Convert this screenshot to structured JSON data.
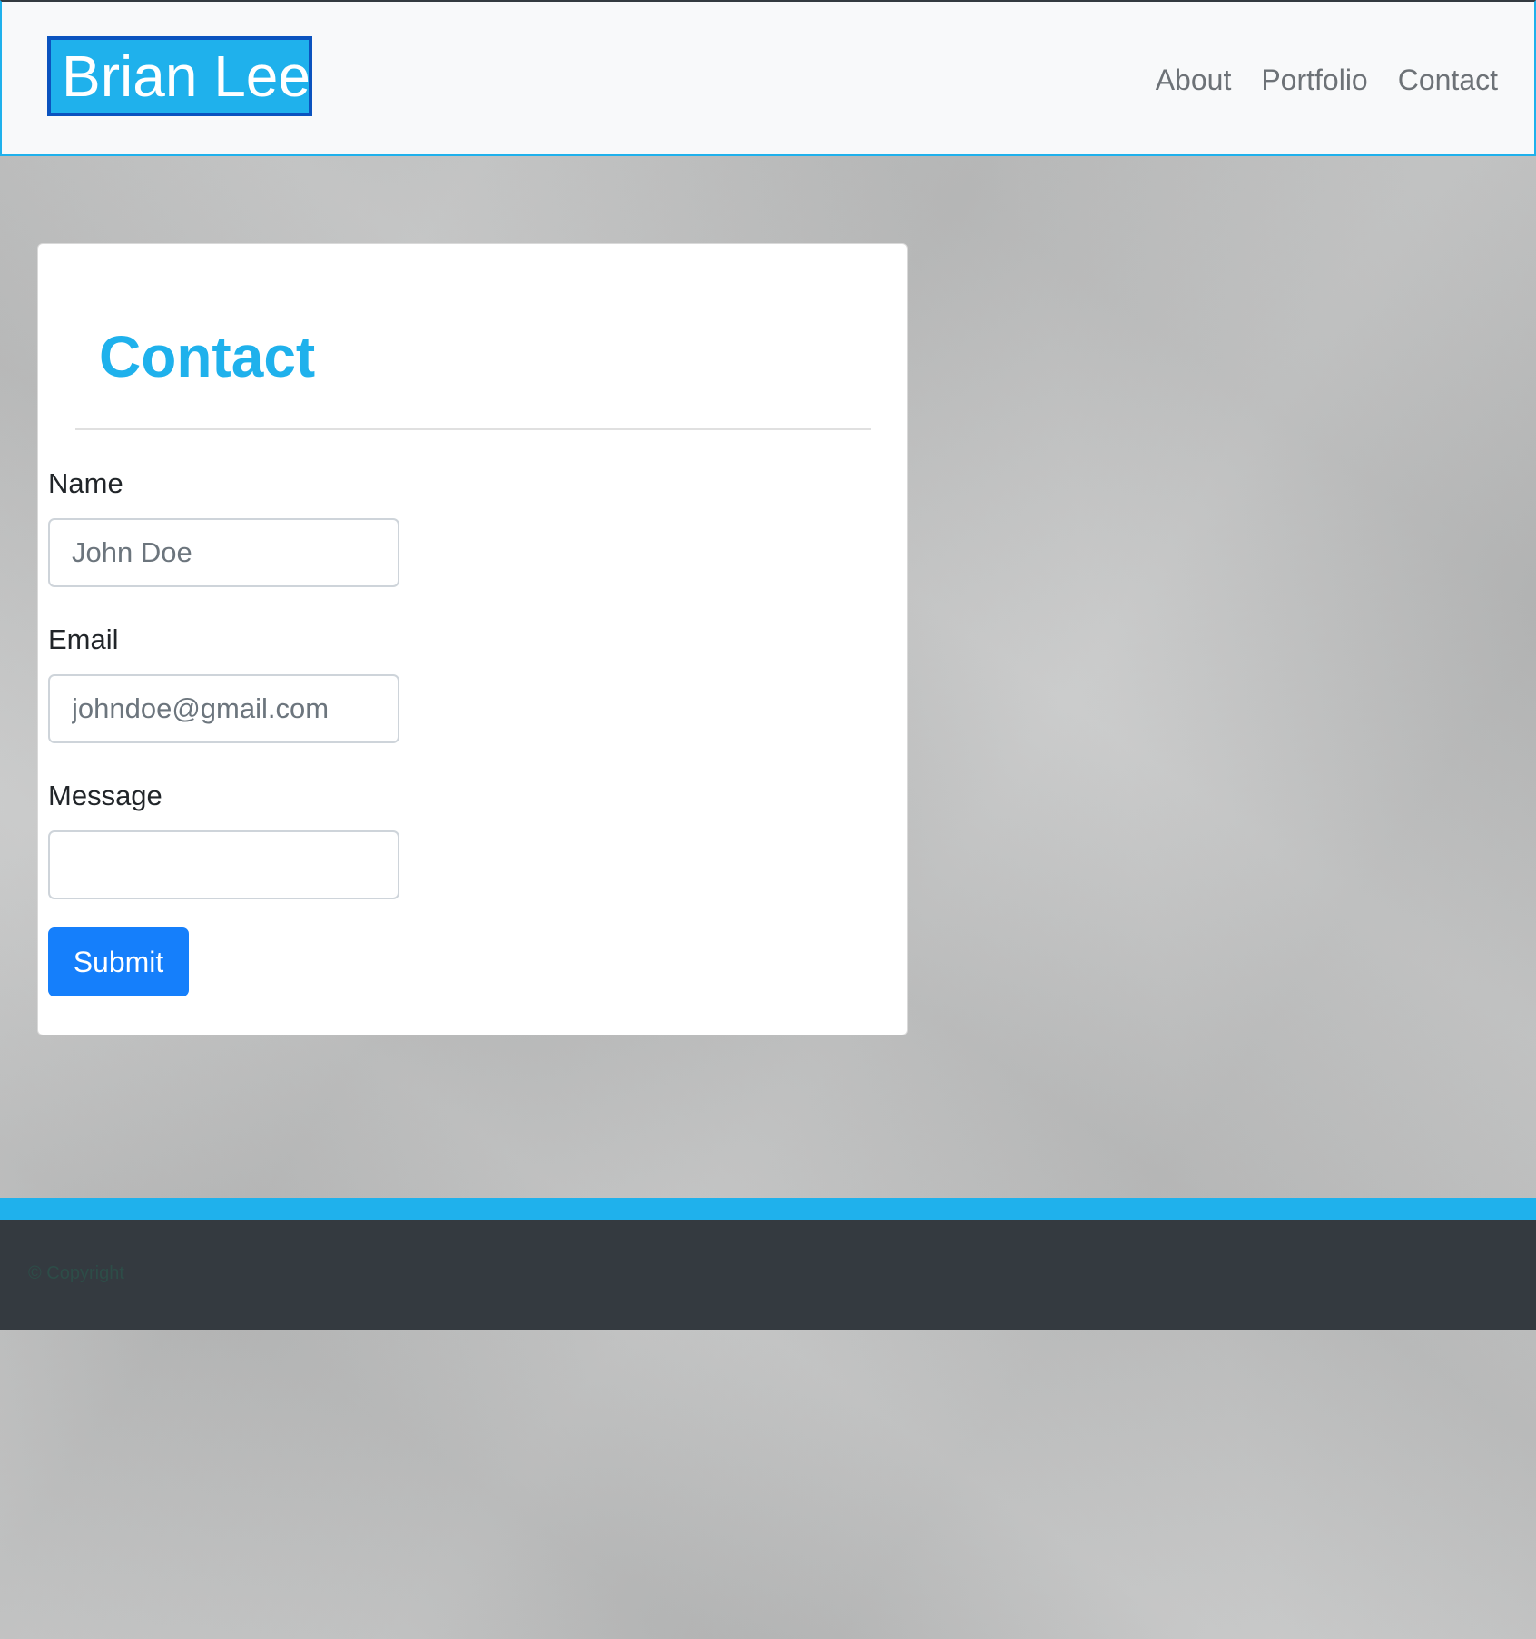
{
  "navbar": {
    "brand": "Brian Lee",
    "links": [
      {
        "label": "About"
      },
      {
        "label": "Portfolio"
      },
      {
        "label": "Contact"
      }
    ]
  },
  "contact_card": {
    "title": "Contact",
    "fields": {
      "name": {
        "label": "Name",
        "value": "",
        "placeholder": "John Doe"
      },
      "email": {
        "label": "Email",
        "value": "",
        "placeholder": "johndoe@gmail.com"
      },
      "message": {
        "label": "Message",
        "value": "",
        "placeholder": ""
      }
    },
    "submit_label": "Submit"
  },
  "footer": {
    "copyright": "© Copyright"
  },
  "colors": {
    "accent": "#1fb1ec",
    "brand_border": "#0b53bf",
    "button": "#157ffb",
    "footer_bg": "#343a40",
    "navbar_bg": "#f8f9fa"
  }
}
